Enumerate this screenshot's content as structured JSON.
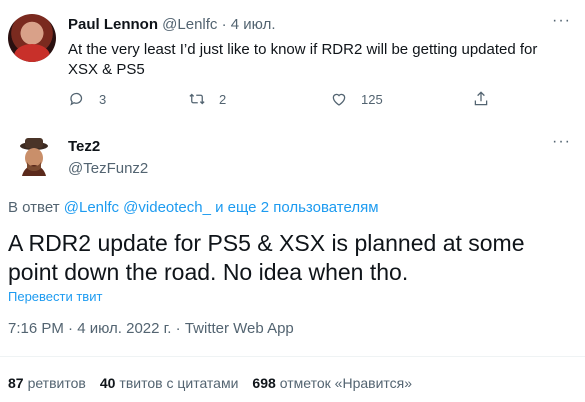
{
  "reply_tweet": {
    "author_name": "Paul Lennon",
    "handle": "@Lenlfc",
    "separator": "·",
    "date": "4 июл.",
    "text": "At the very least I’d just like to know if RDR2 will be getting updated for XSX & PS5",
    "replies": "3",
    "retweets": "2",
    "likes": "125",
    "more": "···"
  },
  "main_tweet": {
    "author_name": "Tez2",
    "handle": "@TezFunz2",
    "more": "···",
    "replying_prefix": "В ответ",
    "replying_mentions": "@Lenlfc @videotech_",
    "replying_suffix": "и еще 2 пользователям",
    "text": "A RDR2 update for PS5 & XSX is planned at some point down the road. No idea when tho.",
    "translate": "Перевести твит",
    "time": "7:16 PM",
    "sep": "·",
    "date": "4 июл. 2022 г.",
    "source": "Twitter Web App",
    "stats": {
      "retweets_count": "87",
      "retweets_label": "ретвитов",
      "quotes_count": "40",
      "quotes_label": "твитов с цитатами",
      "likes_count": "698",
      "likes_label": "отметок «Нравится»"
    }
  },
  "colors": {
    "link": "#1d9bf0",
    "muted": "#536471",
    "text": "#0f1419"
  }
}
